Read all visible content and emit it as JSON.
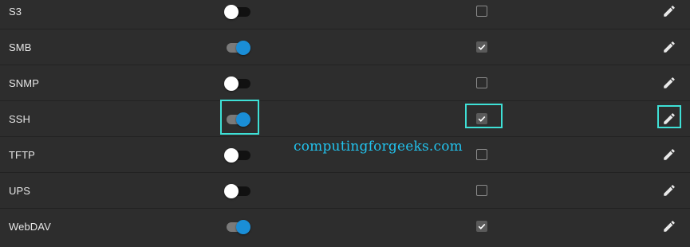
{
  "colors": {
    "background": "#2d2d2d",
    "row_divider": "#222222",
    "text": "#e6e6e6",
    "toggle_on": "#1a8ed7",
    "toggle_off_thumb": "#ffffff",
    "checkbox_checked": "#5a5a5a",
    "highlight": "#3ee0d6",
    "watermark": "#22c3ee"
  },
  "icons": {
    "edit": "pencil-icon",
    "check": "checkmark-icon"
  },
  "services": [
    {
      "name": "S3",
      "running": false,
      "start_automatically": false
    },
    {
      "name": "SMB",
      "running": true,
      "start_automatically": true
    },
    {
      "name": "SNMP",
      "running": false,
      "start_automatically": false
    },
    {
      "name": "SSH",
      "running": true,
      "start_automatically": true
    },
    {
      "name": "TFTP",
      "running": false,
      "start_automatically": false
    },
    {
      "name": "UPS",
      "running": false,
      "start_automatically": false
    },
    {
      "name": "WebDAV",
      "running": true,
      "start_automatically": true
    }
  ],
  "highlighted_service": "SSH",
  "watermark": "computingforgeeks.com"
}
